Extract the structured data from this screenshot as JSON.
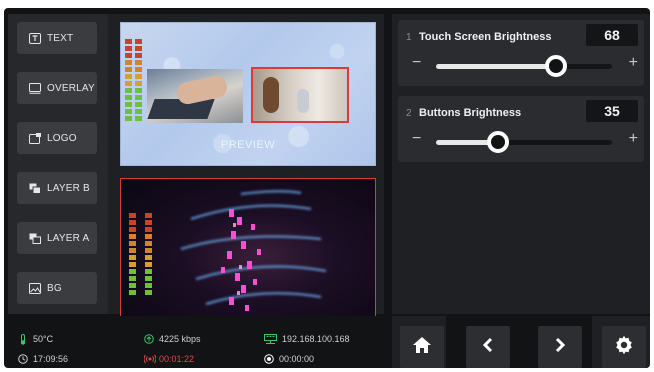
{
  "sources": [
    "TEXT",
    "OVERLAY",
    "LOGO",
    "LAYER B",
    "LAYER A",
    "BG"
  ],
  "preview": {
    "label": "PREVIEW"
  },
  "status": {
    "temperature": "50°C",
    "bitrate": "4225 kbps",
    "ip": "192.168.100.168",
    "clock": "17:09:56",
    "stream_time": "00:01:22",
    "record_time": "00:00:00"
  },
  "settings": [
    {
      "index": "1",
      "title": "Touch Screen Brightness",
      "value": "68",
      "level_percent": 68
    },
    {
      "index": "2",
      "title": "Buttons Brightness",
      "value": "35",
      "level_percent": 35
    }
  ],
  "controls": {
    "minus": "−",
    "plus": "+"
  },
  "icons": {
    "home": "home-icon",
    "back": "chevron-left-icon",
    "forward": "chevron-right-icon",
    "settings": "gear-icon",
    "thermometer": "thermometer-icon",
    "upload": "upload-icon",
    "network": "network-icon",
    "clock": "clock-icon",
    "live": "broadcast-icon",
    "record": "record-icon"
  },
  "colors": {
    "accent_red": "#d83b3b",
    "green": "#3ec46a",
    "stream_red": "#e04a4a",
    "panel": "#1e2023",
    "button": "#3a3c3f"
  }
}
